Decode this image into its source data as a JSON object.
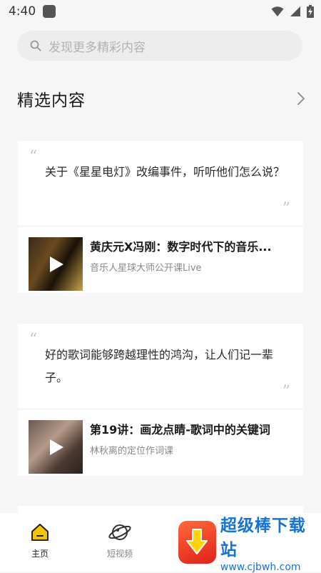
{
  "status_bar": {
    "time": "4:40"
  },
  "search": {
    "placeholder": "发现更多精彩内容"
  },
  "section": {
    "title": "精选内容"
  },
  "feed": [
    {
      "quote": "关于《星星电灯》改编事件，听听他们怎么说？",
      "media_title": "黄庆元X冯刚：数字时代下的音乐...",
      "media_subtitle": "音乐人星球大师公开课Live"
    },
    {
      "quote": "好的歌词能够跨越理性的鸿沟，让人们记一辈子。",
      "media_title": "第19讲：画龙点睛-歌词中的关键词",
      "media_subtitle": "林秋离的定位作词课"
    }
  ],
  "bottom_nav": [
    {
      "label": "主页",
      "icon": "home-icon",
      "active": true
    },
    {
      "label": "短视频",
      "icon": "planet-icon",
      "active": false
    }
  ],
  "watermark": {
    "title": "超级棒下载站",
    "url": "www.cjbwh.com"
  },
  "colors": {
    "accent": "#f5c400",
    "background": "#f6f6f6",
    "watermark_blue": "#1672d8"
  }
}
